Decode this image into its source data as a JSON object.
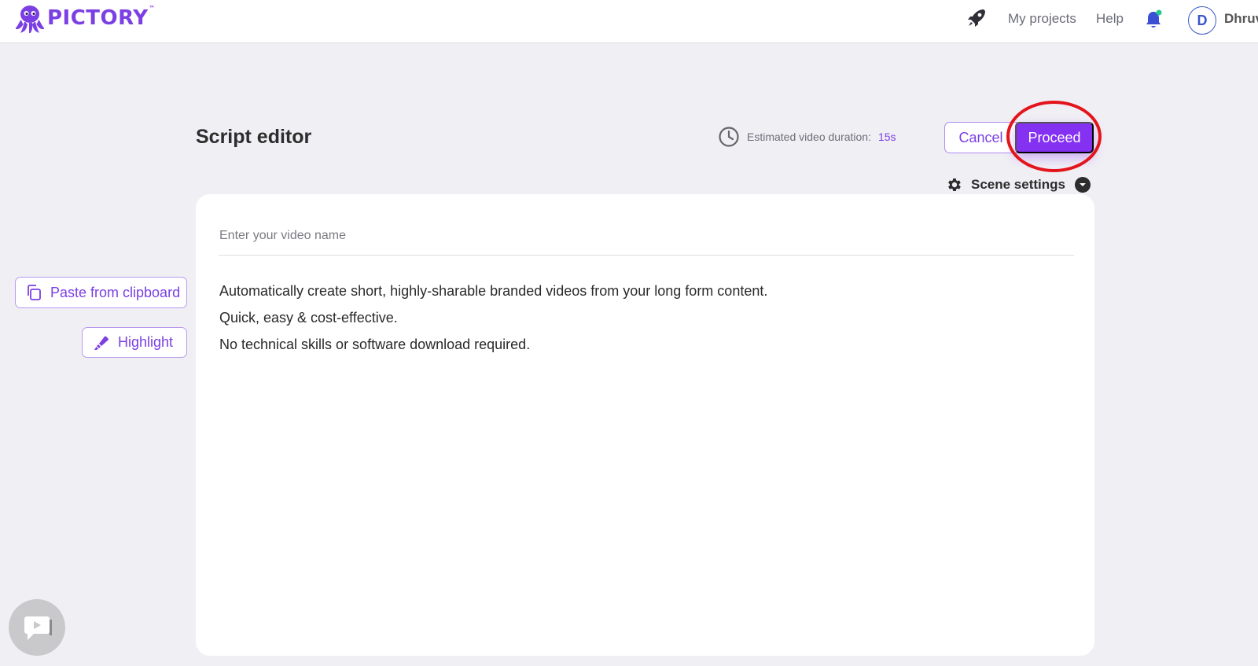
{
  "header": {
    "logo_text": "PICTORY",
    "logo_tm": "™",
    "nav": {
      "my_projects": "My projects",
      "help": "Help"
    },
    "user": {
      "avatar_initial": "D",
      "name": "Dhruv"
    }
  },
  "editor": {
    "title": "Script editor",
    "duration_label": "Estimated video duration:",
    "duration_value": "15s",
    "cancel_label": "Cancel",
    "proceed_label": "Proceed",
    "scene_settings_label": "Scene settings",
    "video_name_placeholder": "Enter your video name",
    "video_name_value": "",
    "script_lines": [
      "Automatically create short, highly-sharable branded videos from your long form content.",
      "Quick, easy & cost-effective.",
      "No technical skills or software download required."
    ]
  },
  "tools": {
    "paste_label": "Paste from clipboard",
    "highlight_label": "Highlight"
  },
  "icons": {
    "logo": "octopus-logo-icon",
    "rocket": "rocket-icon",
    "bell": "bell-icon",
    "clock": "clock-icon",
    "gear": "gear-icon",
    "caret": "chevron-down-icon",
    "copy": "copy-icon",
    "highlighter": "highlighter-icon",
    "chat": "chat-icon"
  },
  "colors": {
    "accent": "#7b3fe4",
    "proceed_bg": "#8431f2",
    "annotation_ring": "#e3141b",
    "background": "#f0eff4"
  }
}
